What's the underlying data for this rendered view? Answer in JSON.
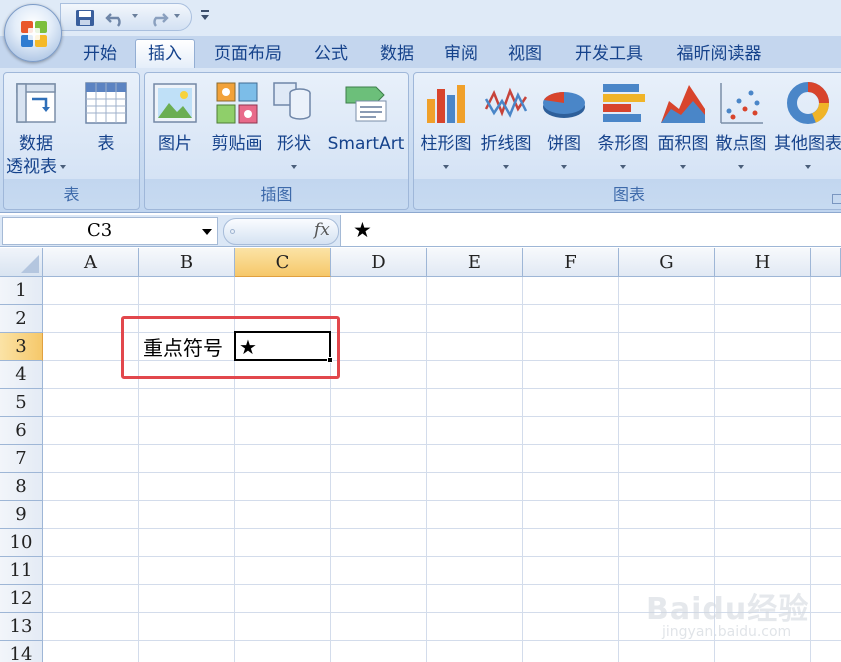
{
  "quick_access": {
    "icons": [
      "office-logo-icon",
      "save-icon",
      "undo-icon",
      "redo-icon",
      "customize-icon"
    ]
  },
  "tabs": [
    {
      "label": "开始",
      "active": false
    },
    {
      "label": "插入",
      "active": true
    },
    {
      "label": "页面布局",
      "active": false
    },
    {
      "label": "公式",
      "active": false
    },
    {
      "label": "数据",
      "active": false
    },
    {
      "label": "审阅",
      "active": false
    },
    {
      "label": "视图",
      "active": false
    },
    {
      "label": "开发工具",
      "active": false
    },
    {
      "label": "福昕阅读器",
      "active": false
    }
  ],
  "ribbon": {
    "groups": [
      {
        "label": "表",
        "buttons": [
          {
            "label_line1": "数据",
            "label_line2": "透视表",
            "icon": "pivot-table-icon",
            "has_dropdown": true
          },
          {
            "label_line1": "表",
            "label_line2": "",
            "icon": "table-icon",
            "has_dropdown": false
          }
        ]
      },
      {
        "label": "插图",
        "buttons": [
          {
            "label_line1": "图片",
            "label_line2": "",
            "icon": "picture-icon",
            "has_dropdown": false
          },
          {
            "label_line1": "剪贴画",
            "label_line2": "",
            "icon": "clipart-icon",
            "has_dropdown": false
          },
          {
            "label_line1": "形状",
            "label_line2": "",
            "icon": "shapes-icon",
            "has_dropdown": true
          },
          {
            "label_line1": "SmartArt",
            "label_line2": "",
            "icon": "smartart-icon",
            "has_dropdown": false
          }
        ]
      },
      {
        "label": "图表",
        "buttons": [
          {
            "label_line1": "柱形图",
            "label_line2": "",
            "icon": "column-chart-icon",
            "has_dropdown": true
          },
          {
            "label_line1": "折线图",
            "label_line2": "",
            "icon": "line-chart-icon",
            "has_dropdown": true
          },
          {
            "label_line1": "饼图",
            "label_line2": "",
            "icon": "pie-chart-icon",
            "has_dropdown": true
          },
          {
            "label_line1": "条形图",
            "label_line2": "",
            "icon": "bar-chart-icon",
            "has_dropdown": true
          },
          {
            "label_line1": "面积图",
            "label_line2": "",
            "icon": "area-chart-icon",
            "has_dropdown": true
          },
          {
            "label_line1": "散点图",
            "label_line2": "",
            "icon": "scatter-chart-icon",
            "has_dropdown": true
          },
          {
            "label_line1": "其他图表",
            "label_line2": "",
            "icon": "other-charts-icon",
            "has_dropdown": true
          }
        ]
      }
    ]
  },
  "formula_bar": {
    "name_box": "C3",
    "fx_label": "fx",
    "formula": "★"
  },
  "sheet": {
    "columns": [
      "A",
      "B",
      "C",
      "D",
      "E",
      "F",
      "G",
      "H"
    ],
    "rows": [
      "1",
      "2",
      "3",
      "4",
      "5",
      "6",
      "7",
      "8",
      "9",
      "10",
      "11",
      "12",
      "13",
      "14"
    ],
    "selected_column": "C",
    "selected_row": "3",
    "cells": {
      "B3": "重点符号",
      "C3": "★"
    }
  },
  "annotation_color": "#e2474c",
  "watermark": {
    "main": "Baidu经验",
    "sub": "jingyan.baidu.com"
  }
}
